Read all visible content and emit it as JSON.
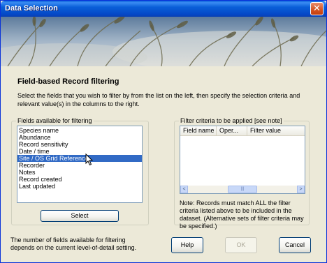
{
  "window": {
    "title": "Data Selection",
    "close_symbol": "✕"
  },
  "page": {
    "heading": "Field-based Record filtering",
    "description": "Select the fields that you wish to filter by from the list on the left, then specify the selection criteria and relevant value(s) in the columns to the right."
  },
  "fields_panel": {
    "label": "Fields available for filtering",
    "items": [
      "Species name",
      "Abundance",
      "Record sensitivity",
      "Date / time",
      "Site / OS Grid Reference",
      "Recorder",
      "Notes",
      "Record created",
      "Last updated"
    ],
    "selected": "Site / OS Grid Reference",
    "select_button": "Select"
  },
  "filter_panel": {
    "label": "Filter criteria to be applied [see note]",
    "columns": [
      "Field name",
      "Oper...",
      "Filter value"
    ],
    "scroll_left": "<",
    "scroll_right": ">",
    "scroll_thumb": "|||",
    "note": "Note: Records must match ALL the filter criteria listed above to be included in the dataset. (Alternative sets of filter criteria may be specified.)"
  },
  "footer": {
    "info": "The number of fields available for filtering depends on the current level-of-detail setting.",
    "help_button": "Help",
    "ok_button": "OK",
    "cancel_button": "Cancel"
  }
}
